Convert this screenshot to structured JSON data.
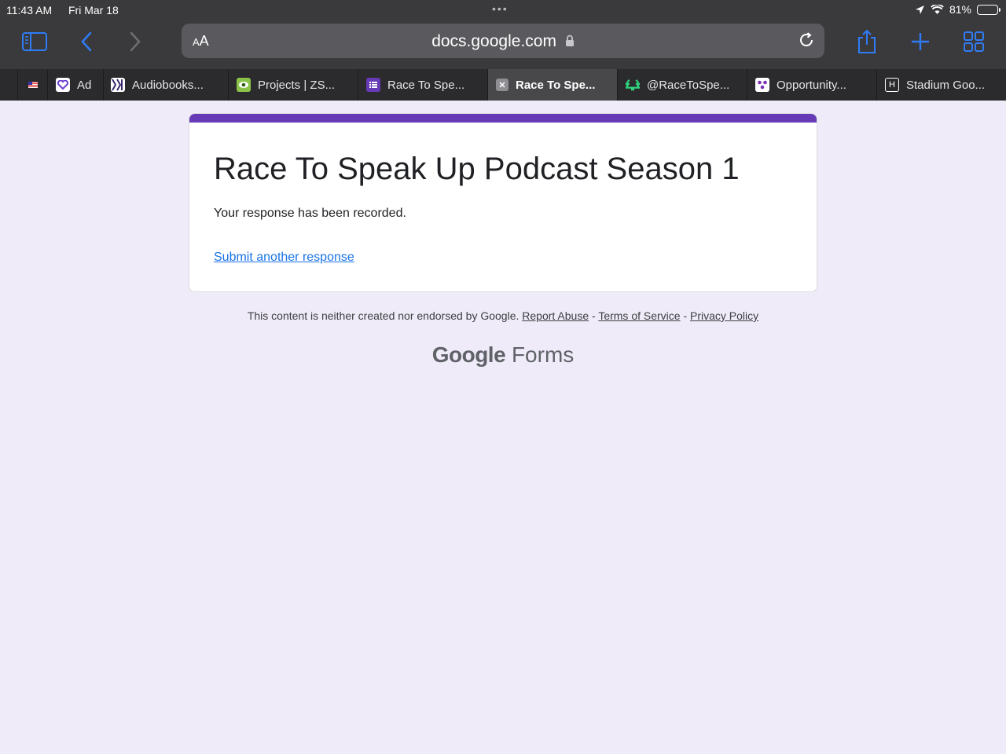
{
  "status_bar": {
    "time": "11:43 AM",
    "date": "Fri Mar 18",
    "battery": "81%",
    "battery_level": 0.81
  },
  "toolbar": {
    "reader_label": "AA",
    "url": "docs.google.com"
  },
  "tabs": [
    {
      "label": "Ad",
      "active": false,
      "color": "#6b3fd1"
    },
    {
      "label": "Audiobooks...",
      "active": false,
      "color": "#ffffff"
    },
    {
      "label": "Projects | ZS...",
      "active": false,
      "color": "#8bc34a"
    },
    {
      "label": "Race To Spe...",
      "active": false,
      "color": "#673ab7"
    },
    {
      "label": "Race To Spe...",
      "active": true,
      "color": "#8e8e93"
    },
    {
      "label": "@RaceToSpe...",
      "active": false,
      "color": "#2fd47c"
    },
    {
      "label": "Opportunity...",
      "active": false,
      "color": "#ffffff"
    },
    {
      "label": "Stadium Goo...",
      "active": false,
      "color": "#2b2b2d"
    }
  ],
  "form": {
    "title": "Race To Speak Up Podcast Season 1",
    "message": "Your response has been recorded.",
    "submit_another": "Submit another response",
    "accent_color": "#673ab7"
  },
  "footer": {
    "disclaimer": "This content is neither created nor endorsed by Google.",
    "report_abuse": "Report Abuse",
    "sep1": " - ",
    "terms": "Terms of Service",
    "sep2": " - ",
    "privacy": "Privacy Policy"
  },
  "brand": {
    "google": "Google",
    "forms": "Forms"
  }
}
